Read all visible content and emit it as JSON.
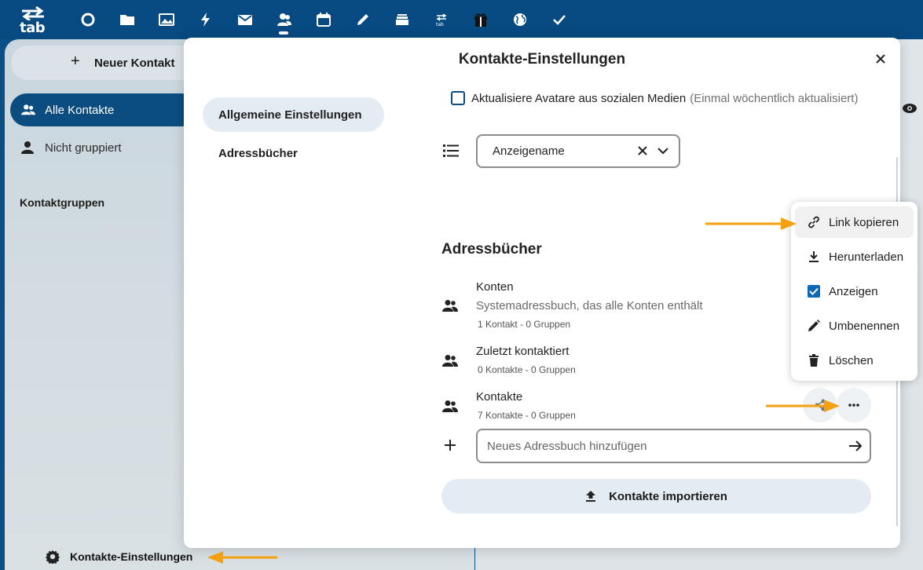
{
  "topbar": {
    "logo_text": "tab",
    "apps": [
      "dashboard-icon",
      "files-icon",
      "photos-icon",
      "activity-icon",
      "mail-icon",
      "contacts-icon",
      "calendar-icon",
      "notes-icon",
      "deck-icon",
      "tab-icon",
      "gift-icon",
      "globe-icon",
      "tasks-icon"
    ],
    "active_app": "contacts-icon"
  },
  "sidebar": {
    "new_contact_label": "Neuer Kontakt",
    "items": [
      {
        "label": "Alle Kontakte",
        "active": true
      },
      {
        "label": "Nicht gruppiert",
        "active": false
      }
    ],
    "groups_heading": "Kontaktgruppen",
    "settings_label": "Kontakte-Einstellungen"
  },
  "modal": {
    "title": "Kontakte-Einstellungen",
    "nav": [
      {
        "label": "Allgemeine Einstellungen",
        "active": true
      },
      {
        "label": "Adressbücher",
        "active": false
      }
    ],
    "avatar_checkbox": {
      "label": "Aktualisiere Avatare aus sozialen Medien",
      "hint": "(Einmal wöchentlich aktualisiert)",
      "checked": false
    },
    "sort_select": {
      "value": "Anzeigename"
    },
    "addressbooks_heading": "Adressbücher",
    "addressbooks": [
      {
        "name": "Konten",
        "description": "Systemadressbuch, das alle Konten enthält",
        "meta": "1 Kontakt  - 0 Gruppen"
      },
      {
        "name": "Zuletzt kontaktiert",
        "description": "",
        "meta": "0 Kontakte  - 0 Gruppen"
      },
      {
        "name": "Kontakte",
        "description": "",
        "meta": "7 Kontakte  - 0 Gruppen"
      }
    ],
    "new_addressbook_placeholder": "Neues Adressbuch hinzufügen",
    "import_label": "Kontakte importieren"
  },
  "menu": {
    "items": [
      {
        "label": "Link kopieren",
        "icon": "link-icon"
      },
      {
        "label": "Herunterladen",
        "icon": "download-icon"
      },
      {
        "label": "Anzeigen",
        "icon": "checkbox-checked-icon",
        "checked": true
      },
      {
        "label": "Umbenennen",
        "icon": "pencil-icon"
      },
      {
        "label": "Löschen",
        "icon": "trash-icon"
      }
    ]
  },
  "colors": {
    "header": "#074a82",
    "accent": "#0b4d80",
    "annotation": "#f5a00f"
  }
}
